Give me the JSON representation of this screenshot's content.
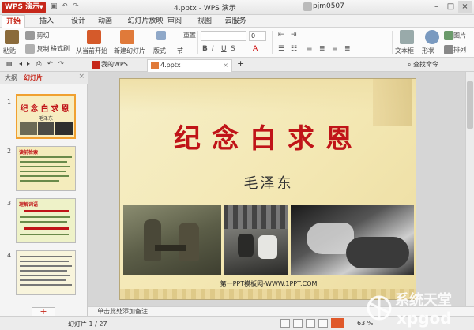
{
  "titlebar": {
    "app_button": "WPS 演示",
    "window_title": "4.pptx - WPS 演示",
    "user": "pjm0507",
    "min": "–",
    "max": "□",
    "close": "×"
  },
  "menu": {
    "tabs": [
      {
        "label": "开始",
        "active": true
      },
      {
        "label": "插入"
      },
      {
        "label": "设计"
      },
      {
        "label": "动画"
      },
      {
        "label": "幻灯片放映"
      },
      {
        "label": "审阅"
      },
      {
        "label": "视图"
      },
      {
        "label": "云服务"
      }
    ]
  },
  "ribbon": {
    "paste": "粘贴",
    "cut": "剪切",
    "copy": "复制",
    "format_painter": "格式刷",
    "from_current": "从当前开始",
    "new_slide": "新建幻灯片",
    "layout": "版式",
    "section": "节",
    "reset": "重置",
    "font_size": "0",
    "textbox": "文本框",
    "shape": "形状",
    "arrange": "排列",
    "picture": "图片"
  },
  "doctabs": {
    "tabs": [
      {
        "label": "我的WPS"
      },
      {
        "label": "4.pptx",
        "active": true
      }
    ],
    "new_tab": "+",
    "search": "查找命令"
  },
  "leftpane": {
    "tabs": [
      "大纲",
      "幻灯片"
    ],
    "close": "×",
    "thumbnails": [
      {
        "num": "1",
        "title": "纪念白求恩",
        "sub": "毛泽东"
      },
      {
        "num": "2",
        "title": "读前检索"
      },
      {
        "num": "3",
        "title": "理解词语"
      },
      {
        "num": "4",
        "title": ""
      }
    ],
    "add": "+"
  },
  "slide": {
    "title": "纪念白求恩",
    "subtitle": "毛泽东",
    "footer": "第一PPT模板网-WWW.1PPT.COM"
  },
  "notes": {
    "placeholder": "单击此处添加备注"
  },
  "statusbar": {
    "slide_info": "幻灯片 1 / 27",
    "zoom": "63 %"
  },
  "watermark": {
    "line1": "系统天堂",
    "line2": "xpgod"
  },
  "colors": {
    "accent": "#c6271a",
    "title_red": "#c01418"
  }
}
